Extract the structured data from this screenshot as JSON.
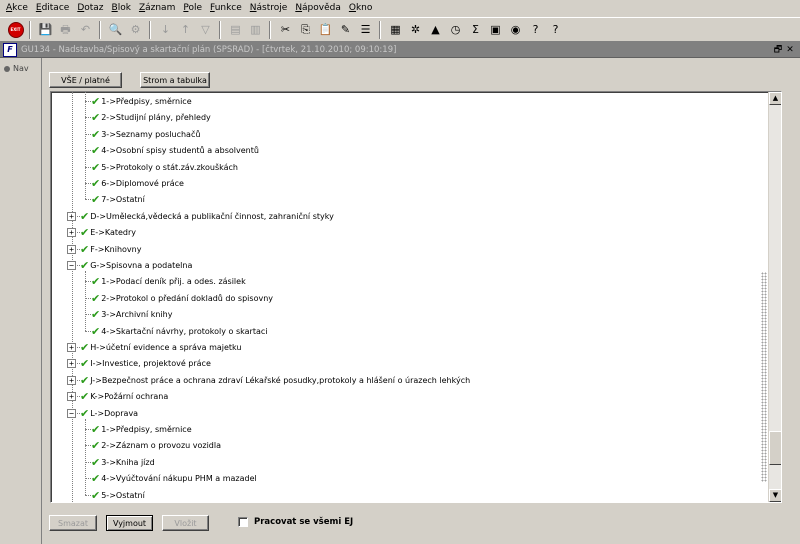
{
  "menu": [
    {
      "label": "Akce",
      "u": "A",
      "rest": "kce"
    },
    {
      "label": "Editace",
      "u": "E",
      "rest": "ditace"
    },
    {
      "label": "Dotaz",
      "u": "D",
      "rest": "otaz"
    },
    {
      "label": "Blok",
      "u": "B",
      "rest": "lok"
    },
    {
      "label": "Záznam",
      "u": "Z",
      "rest": "áznam"
    },
    {
      "label": "Pole",
      "u": "P",
      "rest": "ole"
    },
    {
      "label": "Funkce",
      "u": "F",
      "rest": "unkce"
    },
    {
      "label": "Nástroje",
      "u": "N",
      "rest": "ástroje"
    },
    {
      "label": "Nápověda",
      "u": "N",
      "rest": "ápověda"
    },
    {
      "label": "Okno",
      "u": "O",
      "rest": "kno"
    }
  ],
  "toolbar": {
    "exit_label": "EXIT",
    "icons": [
      {
        "name": "save-icon",
        "glyph": "💾",
        "enabled": false
      },
      {
        "name": "print-icon",
        "glyph": "🖶",
        "enabled": false
      },
      {
        "name": "undo-icon",
        "glyph": "↶",
        "enabled": false
      },
      {
        "name": "sep"
      },
      {
        "name": "query-icon",
        "glyph": "🔍",
        "enabled": false
      },
      {
        "name": "execute-query-icon",
        "glyph": "⚙",
        "enabled": false
      },
      {
        "name": "sep"
      },
      {
        "name": "sort-asc-icon",
        "glyph": "↓",
        "enabled": false
      },
      {
        "name": "sort-desc-icon",
        "glyph": "↑",
        "enabled": false
      },
      {
        "name": "filter-icon",
        "glyph": "▽",
        "enabled": false
      },
      {
        "name": "sep"
      },
      {
        "name": "insert-record-icon",
        "glyph": "▤",
        "enabled": false
      },
      {
        "name": "delete-record-icon",
        "glyph": "▥",
        "enabled": false
      },
      {
        "name": "sep"
      },
      {
        "name": "cut-icon",
        "glyph": "✂",
        "enabled": true
      },
      {
        "name": "copy-icon",
        "glyph": "⎘",
        "enabled": true
      },
      {
        "name": "paste-icon",
        "glyph": "📋",
        "enabled": true
      },
      {
        "name": "edit-icon",
        "glyph": "✎",
        "enabled": true
      },
      {
        "name": "list-icon",
        "glyph": "☰",
        "enabled": true
      },
      {
        "name": "sep"
      },
      {
        "name": "calculator-icon",
        "glyph": "▦",
        "enabled": true
      },
      {
        "name": "settings-icon",
        "glyph": "✲",
        "enabled": true
      },
      {
        "name": "chart-icon",
        "glyph": "▲",
        "enabled": true
      },
      {
        "name": "clock-icon",
        "glyph": "◷",
        "enabled": true
      },
      {
        "name": "sum-icon",
        "glyph": "Σ",
        "enabled": true
      },
      {
        "name": "excel-icon",
        "glyph": "▣",
        "enabled": true
      },
      {
        "name": "web-icon",
        "glyph": "◉",
        "enabled": true
      },
      {
        "name": "help-topic-icon",
        "glyph": "?",
        "enabled": true
      },
      {
        "name": "help-icon",
        "glyph": "?",
        "enabled": true
      }
    ]
  },
  "window": {
    "title": "GU134 - Nadstavba/Spisový a skartační plán (SPSRAD) - [čtvrtek, 21.10.2010; 09:10:19]",
    "app_icon": "F",
    "restore_glyph": "🗗",
    "close_glyph": "✕"
  },
  "nav": {
    "label": "Nav"
  },
  "buttons": {
    "vse": "VŠE / platné",
    "strom": "Strom a tabulka",
    "smazat": "Smazat",
    "vyjmout": "Vyjmout",
    "vlozit": "Vložit"
  },
  "checkbox": {
    "label": "Pracovat se všemi EJ",
    "checked": false
  },
  "tree": [
    {
      "level": 2,
      "text": "1->Předpisy, směrnice"
    },
    {
      "level": 2,
      "text": "2->Studijní plány, přehledy"
    },
    {
      "level": 2,
      "text": "3->Seznamy posluchačů"
    },
    {
      "level": 2,
      "text": "4->Osobní spisy studentů a absolventů"
    },
    {
      "level": 2,
      "text": "5->Protokoly o stát.záv.zkouškách"
    },
    {
      "level": 2,
      "text": "6->Diplomové práce"
    },
    {
      "level": 2,
      "text": "7->Ostatní"
    },
    {
      "level": 1,
      "text": "D->Umělecká,vědecká a publikační činnost, zahraniční styky",
      "state": "+"
    },
    {
      "level": 1,
      "text": "E->Katedry",
      "state": "+"
    },
    {
      "level": 1,
      "text": "F->Knihovny",
      "state": "+"
    },
    {
      "level": 1,
      "text": "G->Spisovna a podatelna",
      "state": "-"
    },
    {
      "level": 2,
      "text": "1->Podací deník přij. a odes. zásilek"
    },
    {
      "level": 2,
      "text": "2->Protokol o předání dokladů do spisovny"
    },
    {
      "level": 2,
      "text": "3->Archivní knihy"
    },
    {
      "level": 2,
      "text": "4->Skartační návrhy, protokoly o skartaci"
    },
    {
      "level": 1,
      "text": "H->účetní evidence a správa majetku",
      "state": "+"
    },
    {
      "level": 1,
      "text": "I->Investice, projektové práce",
      "state": "+"
    },
    {
      "level": 1,
      "text": "J->Bezpečnost práce a ochrana zdraví Lékařské posudky,protokoly a hlášení o úrazech lehkých",
      "state": "+"
    },
    {
      "level": 1,
      "text": "K->Požární ochrana",
      "state": "+"
    },
    {
      "level": 1,
      "text": "L->Doprava",
      "state": "-"
    },
    {
      "level": 2,
      "text": "1->Předpisy, směrnice"
    },
    {
      "level": 2,
      "text": "2->Záznam o provozu vozidla"
    },
    {
      "level": 2,
      "text": "3->Kniha jízd"
    },
    {
      "level": 2,
      "text": "4->Vyúčtování nákupu PHM a mazadel"
    },
    {
      "level": 2,
      "text": "5->Ostatní"
    }
  ],
  "scroll": {
    "position_fraction": 0.93
  }
}
